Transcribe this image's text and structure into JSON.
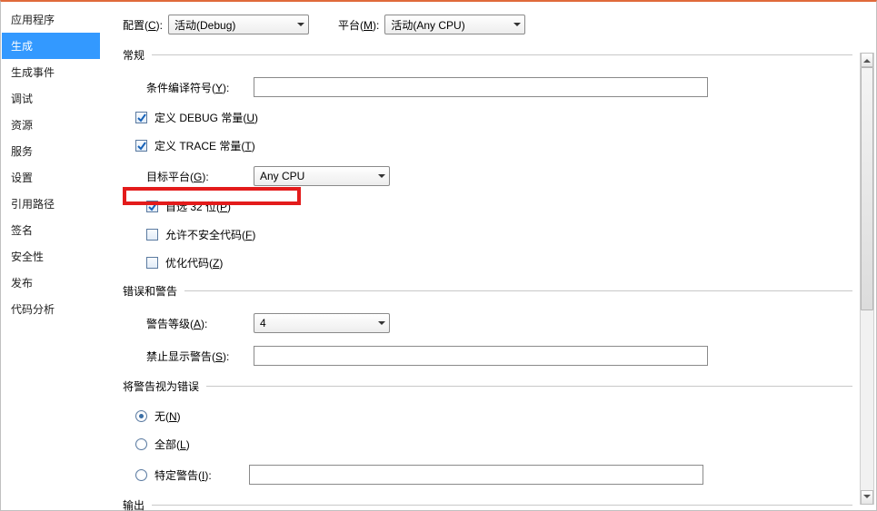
{
  "sidebar": {
    "items": [
      {
        "label": "应用程序"
      },
      {
        "label": "生成"
      },
      {
        "label": "生成事件"
      },
      {
        "label": "调试"
      },
      {
        "label": "资源"
      },
      {
        "label": "服务"
      },
      {
        "label": "设置"
      },
      {
        "label": "引用路径"
      },
      {
        "label": "签名"
      },
      {
        "label": "安全性"
      },
      {
        "label": "发布"
      },
      {
        "label": "代码分析"
      }
    ],
    "selected_index": 1
  },
  "config": {
    "config_label_prefix": "配置(",
    "config_label_key": "C",
    "config_label_suffix": "):",
    "config_value": "活动(Debug)",
    "platform_label_prefix": "平台(",
    "platform_label_key": "M",
    "platform_label_suffix": "):",
    "platform_value": "活动(Any CPU)"
  },
  "sections": {
    "general": "常规",
    "errors": "错误和警告",
    "treat_as_errors": "将警告视为错误",
    "output": "输出"
  },
  "general": {
    "symbols_prefix": "条件编译符号(",
    "symbols_key": "Y",
    "symbols_suffix": "):",
    "symbols_value": "",
    "debug_const_prefix": "定义 DEBUG 常量(",
    "debug_const_key": "U",
    "debug_const_suffix": ")",
    "debug_const_checked": true,
    "trace_const_prefix": "定义 TRACE 常量(",
    "trace_const_key": "T",
    "trace_const_suffix": ")",
    "trace_const_checked": true,
    "target_prefix": "目标平台(",
    "target_key": "G",
    "target_suffix": "):",
    "target_value": "Any CPU",
    "prefer32_prefix": "首选 32 位(",
    "prefer32_key": "P",
    "prefer32_suffix": ")",
    "prefer32_checked": true,
    "unsafe_prefix": "允许不安全代码(",
    "unsafe_key": "F",
    "unsafe_suffix": ")",
    "unsafe_checked": false,
    "optimize_prefix": "优化代码(",
    "optimize_key": "Z",
    "optimize_suffix": ")",
    "optimize_checked": false
  },
  "errors": {
    "level_prefix": "警告等级(",
    "level_key": "A",
    "level_suffix": "):",
    "level_value": "4",
    "suppress_prefix": "禁止显示警告(",
    "suppress_key": "S",
    "suppress_suffix": "):",
    "suppress_value": ""
  },
  "treat": {
    "none_prefix": "无(",
    "none_key": "N",
    "none_suffix": ")",
    "all_prefix": "全部(",
    "all_key": "L",
    "all_suffix": ")",
    "specific_prefix": "特定警告(",
    "specific_key": "I",
    "specific_suffix": "):",
    "specific_value": "",
    "selected": "none"
  }
}
